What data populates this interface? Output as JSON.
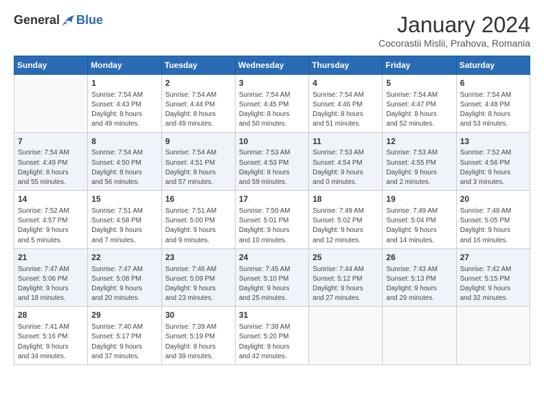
{
  "logo": {
    "general": "General",
    "blue": "Blue"
  },
  "title": "January 2024",
  "subtitle": "Cocorastii Mislii, Prahova, Romania",
  "days": [
    "Sunday",
    "Monday",
    "Tuesday",
    "Wednesday",
    "Thursday",
    "Friday",
    "Saturday"
  ],
  "weeks": [
    [
      {
        "day": "",
        "info": ""
      },
      {
        "day": "1",
        "info": "Sunrise: 7:54 AM\nSunset: 4:43 PM\nDaylight: 8 hours\nand 49 minutes."
      },
      {
        "day": "2",
        "info": "Sunrise: 7:54 AM\nSunset: 4:44 PM\nDaylight: 8 hours\nand 49 minutes."
      },
      {
        "day": "3",
        "info": "Sunrise: 7:54 AM\nSunset: 4:45 PM\nDaylight: 8 hours\nand 50 minutes."
      },
      {
        "day": "4",
        "info": "Sunrise: 7:54 AM\nSunset: 4:46 PM\nDaylight: 8 hours\nand 51 minutes."
      },
      {
        "day": "5",
        "info": "Sunrise: 7:54 AM\nSunset: 4:47 PM\nDaylight: 8 hours\nand 52 minutes."
      },
      {
        "day": "6",
        "info": "Sunrise: 7:54 AM\nSunset: 4:48 PM\nDaylight: 8 hours\nand 53 minutes."
      }
    ],
    [
      {
        "day": "7",
        "info": "Sunrise: 7:54 AM\nSunset: 4:49 PM\nDaylight: 8 hours\nand 55 minutes."
      },
      {
        "day": "8",
        "info": "Sunrise: 7:54 AM\nSunset: 4:50 PM\nDaylight: 8 hours\nand 56 minutes."
      },
      {
        "day": "9",
        "info": "Sunrise: 7:54 AM\nSunset: 4:51 PM\nDaylight: 8 hours\nand 57 minutes."
      },
      {
        "day": "10",
        "info": "Sunrise: 7:53 AM\nSunset: 4:53 PM\nDaylight: 8 hours\nand 59 minutes."
      },
      {
        "day": "11",
        "info": "Sunrise: 7:53 AM\nSunset: 4:54 PM\nDaylight: 9 hours\nand 0 minutes."
      },
      {
        "day": "12",
        "info": "Sunrise: 7:53 AM\nSunset: 4:55 PM\nDaylight: 9 hours\nand 2 minutes."
      },
      {
        "day": "13",
        "info": "Sunrise: 7:52 AM\nSunset: 4:56 PM\nDaylight: 9 hours\nand 3 minutes."
      }
    ],
    [
      {
        "day": "14",
        "info": "Sunrise: 7:52 AM\nSunset: 4:57 PM\nDaylight: 9 hours\nand 5 minutes."
      },
      {
        "day": "15",
        "info": "Sunrise: 7:51 AM\nSunset: 4:58 PM\nDaylight: 9 hours\nand 7 minutes."
      },
      {
        "day": "16",
        "info": "Sunrise: 7:51 AM\nSunset: 5:00 PM\nDaylight: 9 hours\nand 9 minutes."
      },
      {
        "day": "17",
        "info": "Sunrise: 7:50 AM\nSunset: 5:01 PM\nDaylight: 9 hours\nand 10 minutes."
      },
      {
        "day": "18",
        "info": "Sunrise: 7:49 AM\nSunset: 5:02 PM\nDaylight: 9 hours\nand 12 minutes."
      },
      {
        "day": "19",
        "info": "Sunrise: 7:49 AM\nSunset: 5:04 PM\nDaylight: 9 hours\nand 14 minutes."
      },
      {
        "day": "20",
        "info": "Sunrise: 7:48 AM\nSunset: 5:05 PM\nDaylight: 9 hours\nand 16 minutes."
      }
    ],
    [
      {
        "day": "21",
        "info": "Sunrise: 7:47 AM\nSunset: 5:06 PM\nDaylight: 9 hours\nand 18 minutes."
      },
      {
        "day": "22",
        "info": "Sunrise: 7:47 AM\nSunset: 5:08 PM\nDaylight: 9 hours\nand 20 minutes."
      },
      {
        "day": "23",
        "info": "Sunrise: 7:46 AM\nSunset: 5:09 PM\nDaylight: 9 hours\nand 23 minutes."
      },
      {
        "day": "24",
        "info": "Sunrise: 7:45 AM\nSunset: 5:10 PM\nDaylight: 9 hours\nand 25 minutes."
      },
      {
        "day": "25",
        "info": "Sunrise: 7:44 AM\nSunset: 5:12 PM\nDaylight: 9 hours\nand 27 minutes."
      },
      {
        "day": "26",
        "info": "Sunrise: 7:43 AM\nSunset: 5:13 PM\nDaylight: 9 hours\nand 29 minutes."
      },
      {
        "day": "27",
        "info": "Sunrise: 7:42 AM\nSunset: 5:15 PM\nDaylight: 9 hours\nand 32 minutes."
      }
    ],
    [
      {
        "day": "28",
        "info": "Sunrise: 7:41 AM\nSunset: 5:16 PM\nDaylight: 9 hours\nand 34 minutes."
      },
      {
        "day": "29",
        "info": "Sunrise: 7:40 AM\nSunset: 5:17 PM\nDaylight: 9 hours\nand 37 minutes."
      },
      {
        "day": "30",
        "info": "Sunrise: 7:39 AM\nSunset: 5:19 PM\nDaylight: 9 hours\nand 39 minutes."
      },
      {
        "day": "31",
        "info": "Sunrise: 7:38 AM\nSunset: 5:20 PM\nDaylight: 9 hours\nand 42 minutes."
      },
      {
        "day": "",
        "info": ""
      },
      {
        "day": "",
        "info": ""
      },
      {
        "day": "",
        "info": ""
      }
    ]
  ]
}
